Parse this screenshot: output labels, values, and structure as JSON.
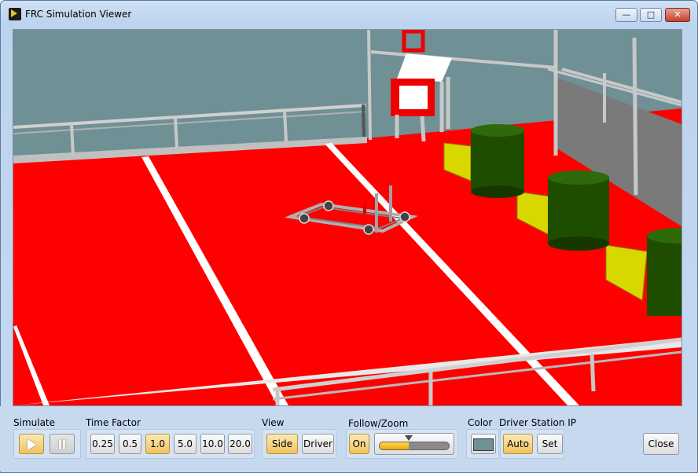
{
  "window": {
    "title": "FRC Simulation Viewer",
    "controls": {
      "minimize": "—",
      "maximize": "□",
      "close": "✕"
    }
  },
  "scene": {
    "description_icon": "3d-field-view",
    "colors": {
      "field": "#ff0000",
      "sky": "#6f9095",
      "tower": "#1f4d00",
      "ramp": "#d8d800",
      "rail": "#c8c8c8",
      "wall": "#7a7a7a"
    }
  },
  "panel": {
    "simulate": {
      "label": "Simulate",
      "play_icon": "play-icon",
      "pause_icon": "pause-icon"
    },
    "time_factor": {
      "label": "Time Factor",
      "options": [
        "0.25",
        "0.5",
        "1.0",
        "5.0",
        "10.0",
        "20.0"
      ],
      "selected": "1.0"
    },
    "view": {
      "label": "View",
      "side": "Side",
      "driver": "Driver",
      "selected": "Side"
    },
    "follow_zoom": {
      "label": "Follow/Zoom",
      "on": "On",
      "zoom_level": 0.42
    },
    "color": {
      "label": "Color",
      "swatch": "#6f9095"
    },
    "driver_station_ip": {
      "label": "Driver Station IP",
      "auto": "Auto",
      "set": "Set"
    },
    "close": "Close"
  },
  "accent": "#f0c25f"
}
